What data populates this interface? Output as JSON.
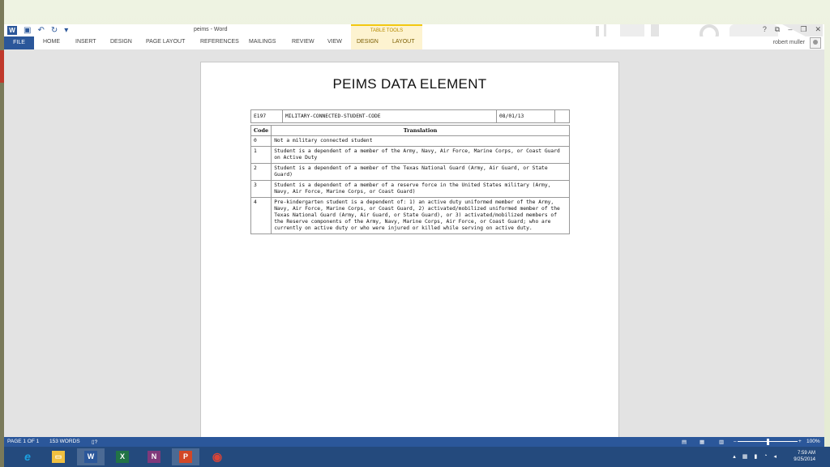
{
  "window": {
    "doc_title": "peims - Word",
    "contextual_tab_group": "TABLE TOOLS",
    "controls": [
      "?",
      "⧉",
      "–",
      "❐",
      "✕"
    ]
  },
  "ribbon": {
    "tabs": [
      "FILE",
      "HOME",
      "INSERT",
      "DESIGN",
      "PAGE LAYOUT",
      "REFERENCES",
      "MAILINGS",
      "REVIEW",
      "VIEW"
    ],
    "table_tools_tabs": [
      "DESIGN",
      "LAYOUT"
    ],
    "user_name": "robert muller"
  },
  "document": {
    "title": "PEIMS DATA ELEMENT",
    "element": {
      "id": "E197",
      "name": "MILITARY-CONNECTED-STUDENT-CODE",
      "date": "08/01/13",
      "extra": ""
    },
    "translation_headers": {
      "code": "Code",
      "translation": "Translation"
    },
    "rows": [
      {
        "code": "0",
        "translation": "Not a military connected student"
      },
      {
        "code": "1",
        "translation": "Student is a dependent of a member of the Army, Navy, Air Force, Marine Corps, or Coast Guard on Active Duty"
      },
      {
        "code": "2",
        "translation": "Student is a dependent of a member of the Texas National Guard (Army, Air Guard, or State Guard)"
      },
      {
        "code": "3",
        "translation": "Student is a dependent of a member of a reserve force in the United States military (Army, Navy, Air Force, Marine Corps, or Coast Guard)"
      },
      {
        "code": "4",
        "translation": "Pre-kindergarten student is a dependent of: 1) an active duty uniformed member of the Army, Navy, Air Force, Marine Corps, or Coast Guard, 2) activated/mobilized uniformed member of the Texas National Guard (Army, Air Guard, or State Guard), or 3) activated/mobilized members of the Reserve components of the Army, Navy, Marine Corps, Air Force, or Coast Guard; who are currently on active duty or who were injured or killed while serving on active duty."
      }
    ]
  },
  "status": {
    "page": "PAGE 1 OF 1",
    "words": "153 WORDS",
    "zoom": "100%",
    "zoom_fraction": 0.5
  },
  "taskbar": {
    "apps": [
      {
        "name": "internet-explorer",
        "glyph": "e",
        "color": "#1ba1e2"
      },
      {
        "name": "file-explorer",
        "glyph": "▭",
        "color": "#f0c040"
      },
      {
        "name": "word",
        "glyph": "W",
        "color": "#2b579a"
      },
      {
        "name": "excel",
        "glyph": "X",
        "color": "#217346"
      },
      {
        "name": "onenote",
        "glyph": "N",
        "color": "#80397b"
      },
      {
        "name": "powerpoint",
        "glyph": "P",
        "color": "#d24726"
      },
      {
        "name": "chrome",
        "glyph": "◉",
        "color": "#db4437"
      }
    ],
    "time": "7:59 AM",
    "date": "9/25/2014"
  },
  "colors": {
    "word_blue": "#2b579a",
    "table_tools_yellow": "#f2c811",
    "taskbar": "#244a7d"
  }
}
